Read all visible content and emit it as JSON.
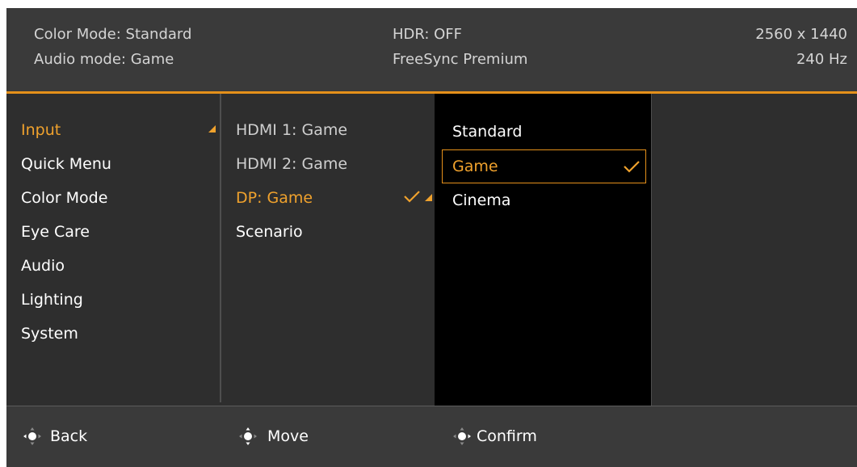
{
  "header": {
    "color_mode": "Color Mode: Standard",
    "audio_mode": "Audio mode: Game",
    "hdr": "HDR: OFF",
    "freesync": "FreeSync Premium",
    "resolution": "2560 x 1440",
    "refresh": "240 Hz"
  },
  "main_menu": {
    "items": [
      "Input",
      "Quick Menu",
      "Color Mode",
      "Eye Care",
      "Audio",
      "Lighting",
      "System"
    ],
    "selected": "Input"
  },
  "input_menu": {
    "items": [
      "HDMI 1: Game",
      "HDMI 2: Game",
      "DP: Game",
      "Scenario"
    ],
    "selected": "DP: Game"
  },
  "mode_menu": {
    "items": [
      "Standard",
      "Game",
      "Cinema"
    ],
    "selected": "Game"
  },
  "footer": {
    "back": "Back",
    "move": "Move",
    "confirm": "Confirm"
  },
  "colors": {
    "accent": "#f0a22d",
    "header_bg": "#3a3a3a",
    "panel_bg": "#2e2e2e",
    "submenu_bg": "#000000"
  },
  "icons": {
    "submenu_arrow": "orange-corner-triangle-icon",
    "check": "checkmark-icon",
    "joystick": "joystick-icon"
  }
}
